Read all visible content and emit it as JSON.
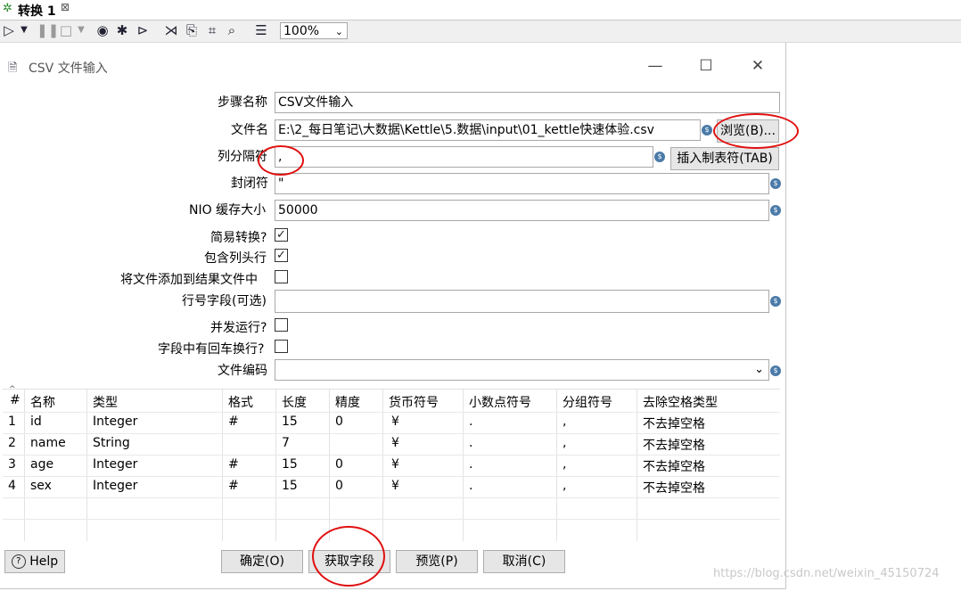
{
  "tab": {
    "title": "转换 1",
    "close": "⊠"
  },
  "toolbar": {
    "zoom": "100%"
  },
  "dialog": {
    "title": "CSV 文件输入",
    "fields": {
      "step_name_label": "步骤名称",
      "step_name": "CSV文件输入",
      "filename_label": "文件名",
      "filename": "E:\\2_每日笔记\\大数据\\Kettle\\5.数据\\input\\01_kettle快速体验.csv",
      "browse": "浏览(B)...",
      "delimiter_label": "列分隔符",
      "delimiter": ",",
      "insert_tab": "插入制表符(TAB)",
      "enclosure_label": "封闭符",
      "enclosure": "\"",
      "nio_label": "NIO 缓存大小",
      "nio": "50000",
      "lazy_label": "简易转换?",
      "header_label": "包含列头行",
      "add_result_label": "将文件添加到结果文件中",
      "rownum_label": "行号字段(可选)",
      "parallel_label": "并发运行?",
      "newline_label": "字段中有回车换行?",
      "encoding_label": "文件编码"
    },
    "checks": {
      "lazy": true,
      "header": true,
      "add_result": false,
      "parallel": false,
      "newline": false
    },
    "table": {
      "headers": [
        "#",
        "名称",
        "类型",
        "格式",
        "长度",
        "精度",
        "货币符号",
        "小数点符号",
        "分组符号",
        "去除空格类型"
      ],
      "rows": [
        [
          "1",
          "id",
          "Integer",
          "#",
          "15",
          "0",
          "¥",
          ".",
          ",",
          "不去掉空格"
        ],
        [
          "2",
          "name",
          "String",
          "",
          "7",
          "",
          "¥",
          ".",
          ",",
          "不去掉空格"
        ],
        [
          "3",
          "age",
          "Integer",
          "#",
          "15",
          "0",
          "¥",
          ".",
          ",",
          "不去掉空格"
        ],
        [
          "4",
          "sex",
          "Integer",
          "#",
          "15",
          "0",
          "¥",
          ".",
          ",",
          "不去掉空格"
        ]
      ]
    },
    "buttons": {
      "help": "Help",
      "ok": "确定(O)",
      "get_fields": "获取字段",
      "preview": "预览(P)",
      "cancel": "取消(C)"
    }
  },
  "watermark": "https://blog.csdn.net/weixin_45150724"
}
